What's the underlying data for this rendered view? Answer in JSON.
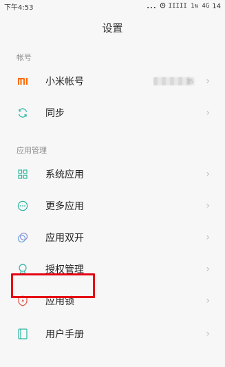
{
  "status_bar": {
    "time": "下午4:53",
    "dots": "...",
    "alarm_icon": "alarm-icon",
    "signal_text": "IIIII 1⇅ 4G",
    "battery": "14"
  },
  "title": "设置",
  "sections": [
    {
      "header": "帐号",
      "items": [
        {
          "label": "小米帐号",
          "icon": "mi-logo-icon",
          "value_blurred": true,
          "value_suffix": "35"
        },
        {
          "label": "同步",
          "icon": "sync-icon"
        }
      ]
    },
    {
      "header": "应用管理",
      "items": [
        {
          "label": "系统应用",
          "icon": "apps-grid-icon"
        },
        {
          "label": "更多应用",
          "icon": "more-circle-icon"
        },
        {
          "label": "应用双开",
          "icon": "dual-circles-icon"
        },
        {
          "label": "授权管理",
          "icon": "badge-icon",
          "highlighted": true
        },
        {
          "label": "应用锁",
          "icon": "shield-lock-icon"
        },
        {
          "label": "用户手册",
          "icon": "book-icon"
        }
      ]
    }
  ],
  "chevron": "›",
  "colors": {
    "accent_teal": "#2bb5a0",
    "mi_orange": "#ff6a00",
    "highlight_red": "#e60012",
    "shield_red": "#e0554a"
  }
}
